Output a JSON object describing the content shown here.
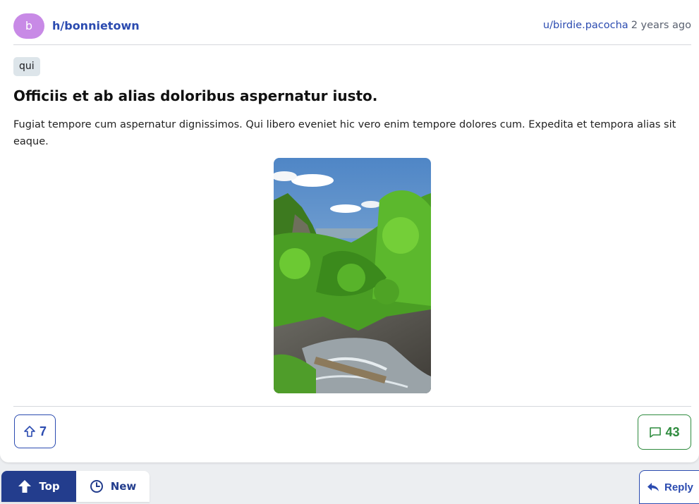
{
  "post": {
    "avatar_letter": "b",
    "hub": "h/bonnietown",
    "author": "u/birdie.pacocha",
    "time": "2 years ago",
    "tag": "qui",
    "title": "Officiis et ab alias doloribus aspernatur iusto.",
    "body": "Fugiat tempore cum aspernatur dignissimos. Qui libero eveniet hic vero enim tempore dolores cum. Expedita et tempora alias sit eaque.",
    "votes": "7",
    "comments": "43"
  },
  "sort": {
    "top": "Top",
    "new": "New"
  },
  "actions": {
    "reply": "Reply"
  },
  "colors": {
    "link": "#2b4bb0",
    "avatar": "#c88ae6",
    "comments_accent": "#2e8b3e",
    "sort_active": "#233d8d"
  },
  "icons": {
    "vote": "arrow-up-outline-icon",
    "comments": "speech-bubble-icon",
    "top": "arrow-up-filled-icon",
    "new": "clock-icon",
    "reply": "reply-arrow-icon"
  }
}
